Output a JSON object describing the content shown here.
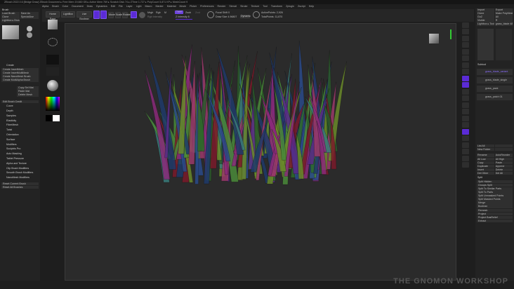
{
  "title": "ZBrush 2022.0.6 [Bridge Draw]  ZBrush Document  ▸ Free Mem 19,660 GB ▸ Active Mem 769 ▸ Scratch Disk 74 ▸ ZTime 1.727 ▸ PolyCount 5,871 KP ▸ MeshCount 9",
  "menu": [
    "Alpha",
    "Brush",
    "Color",
    "Document",
    "Draw",
    "Dynamics",
    "Edit",
    "File",
    "Layer",
    "Light",
    "Macro",
    "Marker",
    "Material",
    "Movie",
    "Picker",
    "Preferences",
    "Render",
    "Stencil",
    "Stroke",
    "Texture",
    "Tool",
    "Transform",
    "Zplugin",
    "Zscript",
    "Help"
  ],
  "toolbar": {
    "home": "Home Page",
    "lightbox": "LightBox",
    "live_boolean": "Live Boolean",
    "edit": "Edit",
    "draw": "Draw",
    "move": "Move",
    "scale": "Scale",
    "rotate": "Rotate",
    "mrgb": "Mrgb",
    "rgb": "Rgb",
    "m": "M",
    "zadd": "Zadd",
    "zsub": "Zsub",
    "zcut": "Zcut",
    "rgb_intensity": "Rgb Intensity",
    "z_intensity": "Z Intensity 8",
    "focal_shift": "Focal Shift 0",
    "draw_size": "Draw Size 4.96807",
    "dynamic": "Dynamic",
    "active_points": "ActivePoints: 2,926",
    "total_points": "TotalPoints: 11,870"
  },
  "left_panel": {
    "title": "Brush",
    "top": [
      "Load Brush",
      "Save As",
      "Clone",
      "SpecialUse",
      "Lightbox ▸ Brushes"
    ],
    "create_title": "Create",
    "create": [
      "Create InsertMesh",
      "Create InsertMultiMesh",
      "Create NanoMesh Brush",
      "Create MultiAlpha Brush"
    ],
    "create2": [
      "Copy Sel Mat",
      "Paste Mat",
      "Delete Mesh"
    ],
    "edit_brush": "Edit Brush Credit",
    "sections": [
      "Curve",
      "Depth",
      "Samples",
      "Elasticity",
      "FiberMesh",
      "Twist",
      "Orientation",
      "Surface",
      "Modifiers",
      "Sculptris Pro",
      "Auto Masking",
      "Tablet Pressure",
      "Alpha and Texture",
      "Clip Brush Modifiers",
      "Smooth Brush Modifiers",
      "NanoMesh Modifiers"
    ],
    "reset": [
      "Reset Current Brush",
      "Reset All Brushes"
    ]
  },
  "right_panel": {
    "top": [
      "Import",
      "Export",
      "Clone",
      "Make PolyMesh3D",
      "GoZ",
      "All",
      "Visible",
      "R",
      "Lightbox ▸ Tools",
      "grass_blade 48"
    ],
    "subtool_title": "Subtool",
    "subtools": [
      "grass_blade_variant",
      "grass_blade_single",
      "grass_pack",
      "grass_patch 01"
    ],
    "list_all": "List All",
    "new_folder": "New Folder",
    "geometry": [
      "Rename",
      "AutoReorder",
      "All Low",
      "All High",
      "Copy",
      "Paste",
      "Duplicate",
      "Append",
      "Insert",
      "Delete",
      "Del Other",
      "Del All"
    ],
    "split_title": "Split",
    "sections": [
      "Merge",
      "Boolean",
      "Remesh",
      "Project",
      "Project BasRelief",
      "Extract"
    ],
    "splits": [
      "Split Hidden",
      "Groups Split",
      "Split To Similar Parts",
      "Split To Parts",
      "Split Unmasked Points",
      "Split Masked Points"
    ]
  },
  "watermark": "THE GNOMON WORKSHOP",
  "colors": {
    "accent": "#5b2bd6",
    "background": "#2b2b2b"
  }
}
